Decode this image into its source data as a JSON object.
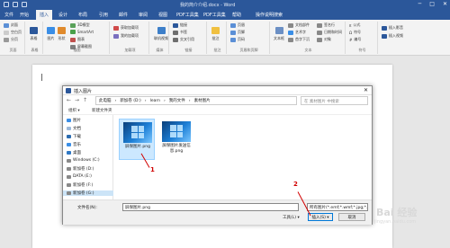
{
  "window": {
    "doc_title": "我的简介介绍.docx - Word",
    "tell": "操作说明搜索"
  },
  "tabs": [
    "文件",
    "开始",
    "插入",
    "设计",
    "布局",
    "引用",
    "邮件",
    "审阅",
    "视图",
    "PDF工具集",
    "PDF工具集",
    "帮助"
  ],
  "ribbon": {
    "groups": [
      {
        "label": "页面",
        "items": [
          "封面",
          "空白页",
          "分页"
        ]
      },
      {
        "label": "表格",
        "items": [
          "表格"
        ]
      },
      {
        "label": "插图",
        "items": [
          "图片",
          "形状",
          "3D模型",
          "SmartArt",
          "图表",
          "屏幕截图"
        ]
      },
      {
        "label": "加载项",
        "items": [
          "获取加载项",
          "我的加载项"
        ]
      },
      {
        "label": "媒体",
        "items": [
          "联机视频"
        ]
      },
      {
        "label": "链接",
        "items": [
          "链接",
          "书签",
          "交叉引用"
        ]
      },
      {
        "label": "批注",
        "items": [
          "批注"
        ]
      },
      {
        "label": "页眉和页脚",
        "items": [
          "页眉",
          "页脚",
          "页码"
        ]
      },
      {
        "label": "文本",
        "items": [
          "文本框",
          "文档部件",
          "艺术字",
          "首字下沉",
          "签名行",
          "日期和时间",
          "对象"
        ]
      },
      {
        "label": "符号",
        "items": [
          "公式",
          "符号",
          "编号"
        ]
      },
      {
        "label": "",
        "items": [
          "插入影音",
          "插入视频"
        ]
      }
    ]
  },
  "dialog": {
    "title": "插入图片",
    "address": [
      "此电脑",
      "新加卷 (D:)",
      "learn",
      "我的文件",
      "素材图片"
    ],
    "search_placeholder": "在 素材图片 中搜索",
    "toolbar": {
      "organize": "组织 ▾",
      "new_folder": "新建文件夹"
    },
    "sidebar": [
      {
        "label": "图片",
        "icon": "picture-icon",
        "color": "#3a8ee6"
      },
      {
        "label": "文档",
        "icon": "document-icon",
        "color": "#9cb8d8"
      },
      {
        "label": "下载",
        "icon": "download-icon",
        "color": "#2b6cb0"
      },
      {
        "label": "音乐",
        "icon": "music-icon",
        "color": "#3a8ee6"
      },
      {
        "label": "桌面",
        "icon": "desktop-icon",
        "color": "#2f78c4"
      },
      {
        "label": "Windows (C:)",
        "icon": "drive-icon",
        "color": "#888888"
      },
      {
        "label": "新加卷 (D:)",
        "icon": "drive-icon",
        "color": "#888888"
      },
      {
        "label": "DATA (E:)",
        "icon": "drive-icon",
        "color": "#888888"
      },
      {
        "label": "新加卷 (F:)",
        "icon": "drive-icon",
        "color": "#888888"
      },
      {
        "label": "新加卷 (G:)",
        "icon": "drive-icon",
        "color": "#888888"
      }
    ],
    "files": [
      {
        "name": "屏保图片.png",
        "selected": true
      },
      {
        "name": "屏保图片发送信息.png",
        "selected": false
      }
    ],
    "filename_label": "文件名(N):",
    "filename_value": "屏保图片.png",
    "filetype": "所有图片(*.emf;*.wmf;*.jpg;*.j",
    "tools": "工具(L) ▾",
    "insert": "插入(S) ▾",
    "cancel": "取消"
  },
  "annotations": {
    "one": "1",
    "two": "2"
  },
  "watermark": {
    "main": "Bai 经验",
    "sub": "jingyan.baidu.com"
  }
}
